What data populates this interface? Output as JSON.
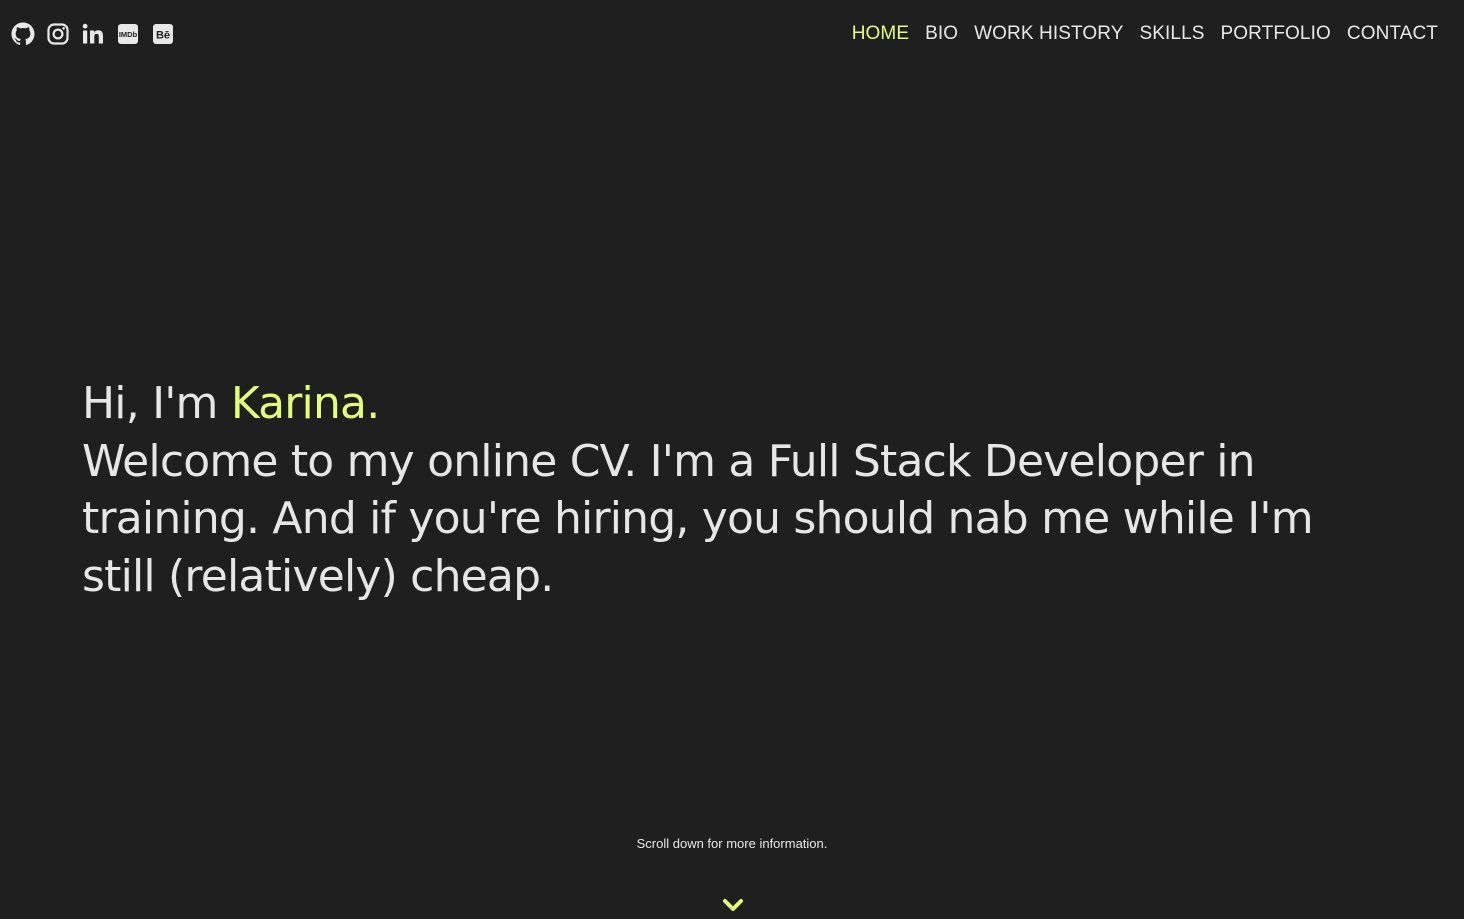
{
  "social": [
    {
      "icon": "github-icon"
    },
    {
      "icon": "instagram-icon"
    },
    {
      "icon": "linkedin-icon"
    },
    {
      "icon": "imdb-icon"
    },
    {
      "icon": "behance-icon"
    }
  ],
  "nav": {
    "items": [
      {
        "label": "HOME"
      },
      {
        "label": "BIO"
      },
      {
        "label": "WORK HISTORY"
      },
      {
        "label": "SKILLS"
      },
      {
        "label": "PORTFOLIO"
      },
      {
        "label": "CONTACT"
      }
    ]
  },
  "hero": {
    "greeting": "Hi, I'm ",
    "name": "Karina.",
    "intro": "Welcome to my online CV. I'm a Full Stack Developer in training. And if you're hiring, you should nab me while I'm still (relatively) cheap."
  },
  "scroll": {
    "hint": "Scroll down for more information.",
    "icon": "chevron-down-icon"
  },
  "colors": {
    "background": "#1f1f1f",
    "accent": "#e4ff7a",
    "text": "#e8e8e8"
  }
}
